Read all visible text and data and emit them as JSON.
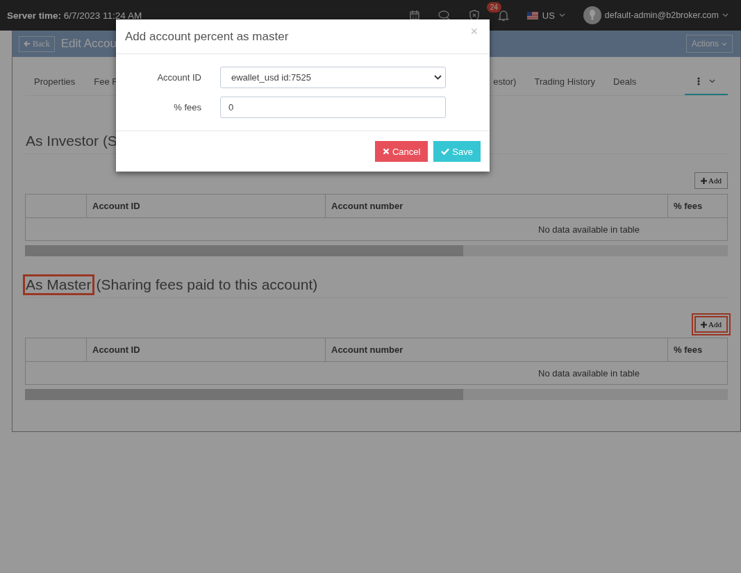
{
  "top_bar": {
    "server_time_label": "Server time:",
    "server_time": "6/7/2023 11:24 AM",
    "notification_count": "24",
    "language": "US",
    "user": "default-admin@b2broker.com"
  },
  "panel": {
    "back_button": "Back",
    "title": "Edit Accou",
    "actions_button": "Actions"
  },
  "tabs": [
    {
      "label": "Properties",
      "selected": false
    },
    {
      "label": "Fee F",
      "selected": false
    },
    {
      "label": "estor)",
      "selected": false
    },
    {
      "label": "Trading History",
      "selected": false
    },
    {
      "label": "Deals",
      "selected": false
    },
    {
      "kind": "more",
      "selected": true
    }
  ],
  "sections": [
    {
      "title": "As Investor (S",
      "highlighted": false,
      "add_button": "Add",
      "add_highlighted": false,
      "columns": [
        "",
        "Account ID",
        "Account number",
        "% fees"
      ],
      "empty_message": "No data available in table"
    },
    {
      "title": "As Master",
      "subtitle": "(Sharing fees paid to this account)",
      "highlighted": true,
      "add_button": "Add",
      "add_highlighted": true,
      "columns": [
        "",
        "Account ID",
        "Account number",
        "% fees"
      ],
      "empty_message": "No data available in table"
    }
  ],
  "modal": {
    "title": "Add account percent as master",
    "close": "×",
    "fields": [
      {
        "kind": "select",
        "label": "Account ID",
        "value": "ewallet_usd id:7525"
      },
      {
        "kind": "text",
        "label": "% fees",
        "value": "0"
      }
    ],
    "cancel_button": "Cancel",
    "save_button": "Save"
  }
}
